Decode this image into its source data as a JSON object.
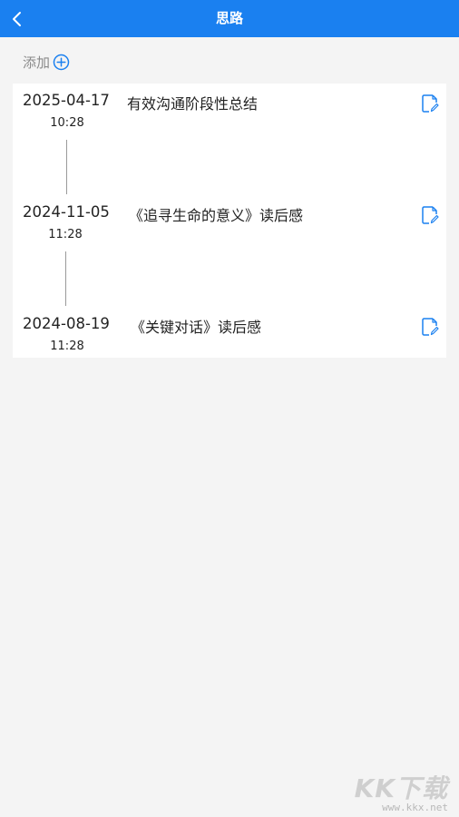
{
  "header": {
    "title": "思路"
  },
  "add": {
    "label": "添加"
  },
  "entries": [
    {
      "date": "2025-04-17",
      "time": "10:28",
      "title": "有效沟通阶段性总结"
    },
    {
      "date": "2024-11-05",
      "time": "11:28",
      "title": "《追寻生命的意义》读后感"
    },
    {
      "date": "2024-08-19",
      "time": "11:28",
      "title": "《关键对话》读后感"
    }
  ],
  "watermark": {
    "brand": "KK下载",
    "url": "www.kkx.net"
  },
  "colors": {
    "header_bg": "#1a80f0",
    "accent": "#1a80f0",
    "page_bg": "#f4f4f4"
  }
}
